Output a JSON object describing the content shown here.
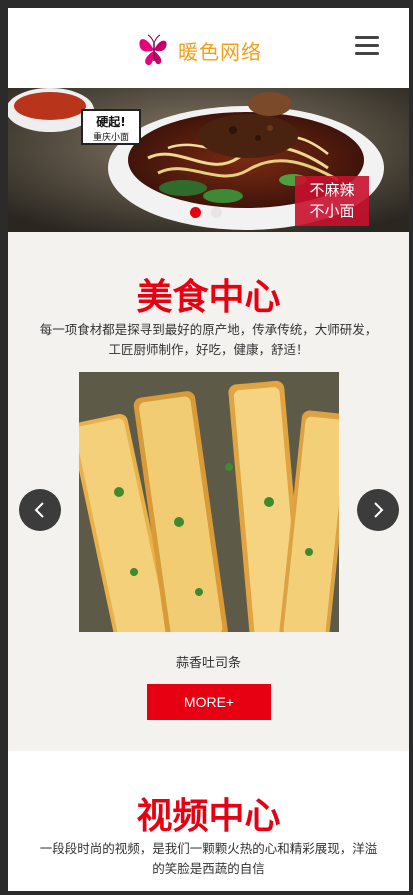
{
  "header": {
    "logo_text": "暖色网络",
    "logo_icon": "butterfly-icon",
    "menu_icon": "hamburger-menu-icon"
  },
  "banner": {
    "badge_text_1": "硬起!",
    "badge_text_2": "重庆小面",
    "stamp_line_1": "不麻辣",
    "stamp_line_2": "不小面",
    "slides": 2,
    "active_slide": 1
  },
  "food_section": {
    "title": "美食中心",
    "description": "每一项食材都是探寻到最好的原产地，传承传统，大师研发，工匠厨师制作，好吃，健康，舒适！",
    "item_caption": "蒜香吐司条",
    "prev_icon": "chevron-left-icon",
    "next_icon": "chevron-right-icon",
    "more_label": "MORE+"
  },
  "video_section": {
    "title": "视频中心",
    "description": "一段段时尚的视频，是我们一颗颗火热的心和精彩展现，洋溢的笑脸是西蔬的自信"
  },
  "colors": {
    "accent": "#e60012",
    "logo_text": "#f0a01c",
    "section_bg": "#f4f2ee",
    "arrow_bg": "#3c3c3c"
  }
}
